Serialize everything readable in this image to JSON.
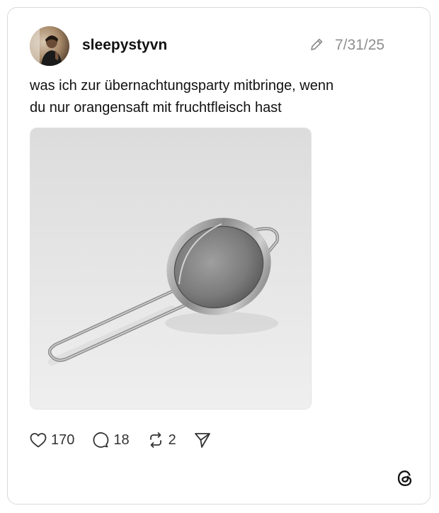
{
  "post": {
    "username": "sleepystyvn",
    "date": "7/31/25",
    "text_lines": [
      "was ich zur übernachtungsparty mitbringe, wenn",
      "du nur orangensaft mit fruchtfleisch hast"
    ],
    "image_subject": "stainless steel fine-mesh strainer on grey background"
  },
  "actions": {
    "likes": "170",
    "replies": "18",
    "reposts": "2"
  },
  "icons": {
    "edit": "pencil-icon",
    "like": "heart-icon",
    "reply": "speech-bubble-icon",
    "repost": "repost-arrows-icon",
    "share": "send-arrow-icon",
    "brand": "threads-logo-icon"
  },
  "colors": {
    "text": "#111111",
    "muted": "#8e8e8e",
    "border": "#d9d9d9"
  }
}
